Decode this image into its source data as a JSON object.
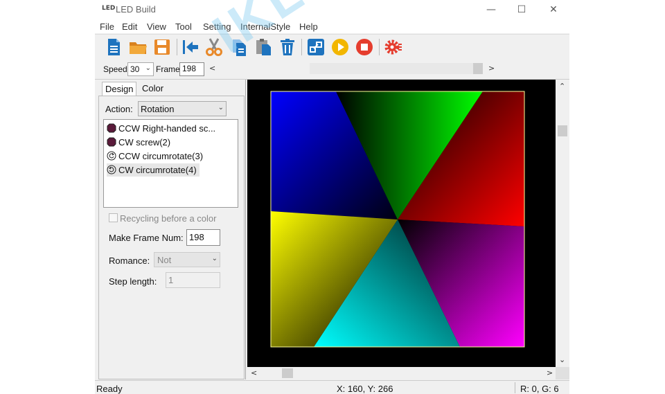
{
  "window": {
    "app_icon_text": "LED",
    "title": "LED Build",
    "controls": [
      "—",
      "☐",
      "✕"
    ]
  },
  "menu": [
    "File",
    "Edit",
    "View",
    "Tool",
    "Setting",
    "InternalStyle",
    "Help"
  ],
  "toolbar": {
    "buttons": [
      "new-icon",
      "open-folder-icon",
      "save-icon",
      "go-first-icon",
      "cut-icon",
      "copy-icon",
      "paste-icon",
      "delete-icon",
      "link-icon",
      "play-icon",
      "stop-icon",
      "settings-gear-icon"
    ],
    "colors": {
      "blue": "#1e73be",
      "orange": "#e8892a",
      "yellow": "#f2b600",
      "red": "#e53d2e"
    }
  },
  "speedbar": {
    "speed_label": "Speed:",
    "speed_value": "30",
    "frame_label": "Frame:",
    "frame_value": "198",
    "left_arrow": "<",
    "right_arrow": ">"
  },
  "left_panel": {
    "tabs": [
      "Design",
      "Color"
    ],
    "action_label": "Action:",
    "action_value": "Rotation",
    "list_items": [
      "CCW Right-handed sc...",
      "CW screw(2)",
      "CCW circumrotate(3)",
      "CW circumrotate(4)"
    ],
    "recycling_label": "Recycling before a color",
    "make_frame_label": "Make Frame Num:",
    "make_frame_value": "198",
    "romance_label": "Romance:",
    "romance_value": "Not",
    "step_label": "Step length:",
    "step_value": "1"
  },
  "canvas": {
    "colors": [
      "#0000ff",
      "#00ff00",
      "#ff0000",
      "#ff00ff",
      "#00ffff",
      "#ffff00"
    ],
    "background": "#000000",
    "border": "#ffff99"
  },
  "status": {
    "ready": "Ready",
    "coords": "X: 160, Y: 266",
    "rgb": "R:  0, G: 6"
  },
  "watermark": "IKLED"
}
